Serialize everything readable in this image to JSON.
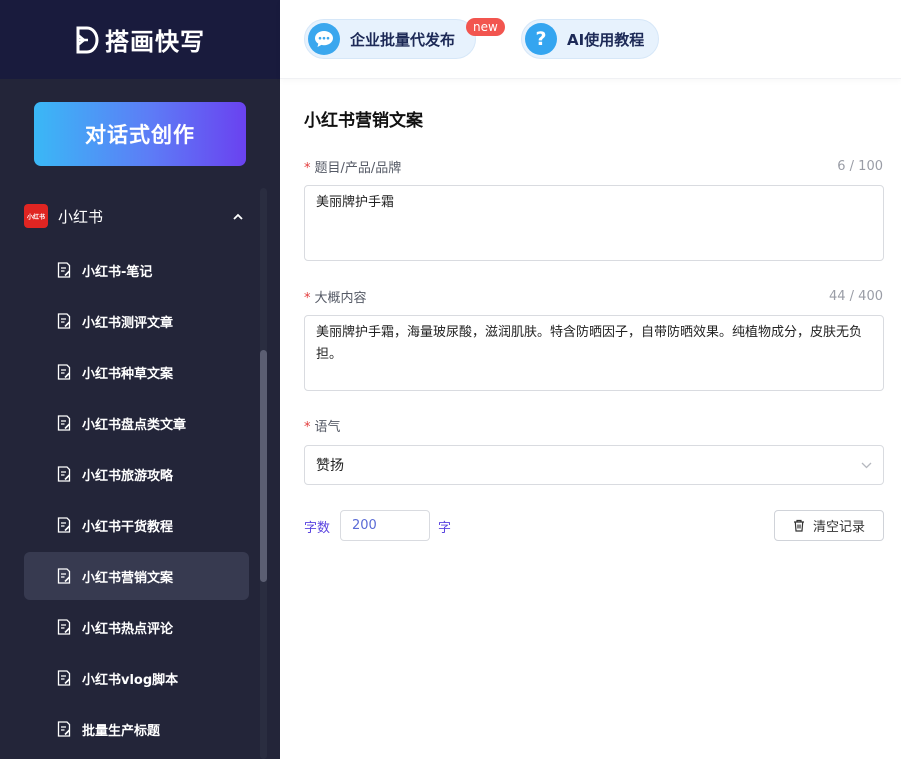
{
  "brand": {
    "name": "搭画快写"
  },
  "sidebar": {
    "create_button": "对话式创作",
    "group": {
      "logo_text": "小红书",
      "title": "小红书"
    },
    "items": [
      {
        "label": "小红书-笔记"
      },
      {
        "label": "小红书测评文章"
      },
      {
        "label": "小红书种草文案"
      },
      {
        "label": "小红书盘点类文章"
      },
      {
        "label": "小红书旅游攻略"
      },
      {
        "label": "小红书干货教程"
      },
      {
        "label": "小红书营销文案"
      },
      {
        "label": "小红书热点评论"
      },
      {
        "label": "小红书vlog脚本"
      },
      {
        "label": "批量生产标题"
      }
    ],
    "active_index": 6
  },
  "topbar": {
    "enterprise_label": "企业批量代发布",
    "new_badge": "new",
    "tutorial_label": "AI使用教程",
    "tutorial_icon_text": "?"
  },
  "form": {
    "title": "小红书营销文案",
    "topic": {
      "label": "题目/产品/品牌",
      "counter": "6 / 100",
      "value": "美丽牌护手霜"
    },
    "content": {
      "label": "大概内容",
      "counter": "44 / 400",
      "value": "美丽牌护手霜，海量玻尿酸，滋润肌肤。特含防晒因子，自带防晒效果。纯植物成分，皮肤无负担。"
    },
    "tone": {
      "label": "语气",
      "value": "赞扬"
    },
    "word_count": {
      "prefix": "字数",
      "value": "200",
      "suffix": "字"
    },
    "clear_button": "清空记录"
  },
  "colors": {
    "sidebar_bg": "#232539",
    "brand_bg": "#191b3d",
    "accent_purple": "#5a44e0",
    "required_red": "#e23b3b",
    "badge_red": "#f2554f"
  }
}
